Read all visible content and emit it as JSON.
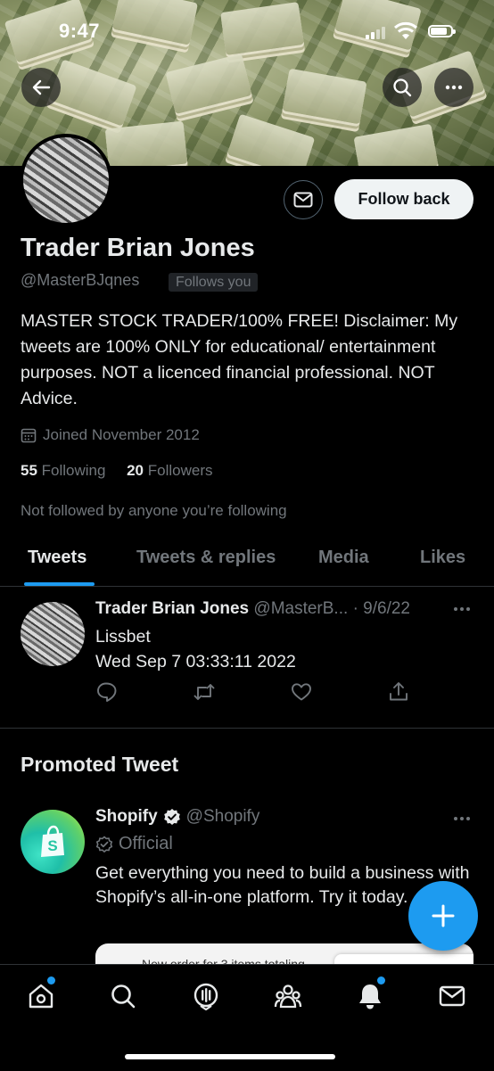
{
  "status_bar": {
    "time": "9:47"
  },
  "profile": {
    "name": "Trader Brian Jones",
    "handle": "@MasterBJqnes",
    "follows_you_badge": "Follows you",
    "follow_back_label": "Follow back",
    "bio": "MASTER STOCK TRADER/100% FREE! Disclaimer: My tweets are 100% ONLY for educational/ entertainment purposes. NOT a licenced financial professional. NOT Advice.",
    "joined": "Joined November 2012",
    "following_count": "55",
    "following_label": "Following",
    "followers_count": "20",
    "followers_label": "Followers",
    "not_followed_text": "Not followed by anyone you’re following"
  },
  "tabs": [
    {
      "label": "Tweets",
      "active": true
    },
    {
      "label": "Tweets & replies",
      "active": false
    },
    {
      "label": "Media",
      "active": false
    },
    {
      "label": "Likes",
      "active": false
    }
  ],
  "tweet": {
    "author": "Trader Brian Jones",
    "handle": "@MasterB...",
    "date": "· 9/6/22",
    "line1": "Lissbet",
    "line2": "Wed Sep  7 03:33:11 2022"
  },
  "promoted": {
    "section_title": "Promoted Tweet",
    "author": "Shopify",
    "handle": "@Shopify",
    "official_label": "Official",
    "body": "Get everything you need to build a business with Shopify’s all-in-one platform. Try it today.",
    "card_text": "New order for 3 items totaling"
  },
  "colors": {
    "accent": "#1d9bf0",
    "muted": "#71767b",
    "text": "#e7e9ea",
    "background": "#000000"
  },
  "icons": [
    "back-arrow-icon",
    "search-icon",
    "more-icon",
    "mail-icon",
    "calendar-icon",
    "reply-icon",
    "retweet-icon",
    "like-icon",
    "share-icon",
    "verified-badge-icon",
    "official-check-icon",
    "shopify-bag-icon",
    "plus-icon",
    "home-icon",
    "explore-icon",
    "spaces-icon",
    "communities-icon",
    "notifications-icon",
    "messages-icon"
  ]
}
